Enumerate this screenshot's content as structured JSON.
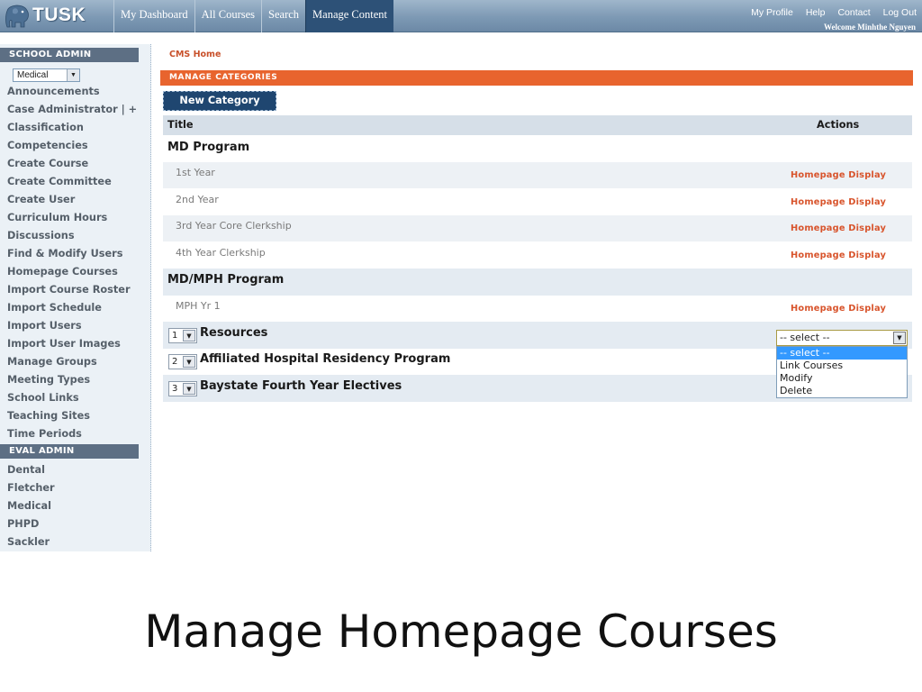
{
  "app": {
    "logo_text": "TUSK",
    "nav_tabs": [
      {
        "label": "My Dashboard"
      },
      {
        "label": "All Courses"
      },
      {
        "label": "Search"
      },
      {
        "label": "Manage Content",
        "active": true
      }
    ],
    "user_links": [
      "My Profile",
      "Help",
      "Contact",
      "Log Out"
    ],
    "welcome": "Welcome Minhthe Nguyen"
  },
  "sidebar": {
    "school_admin_header": "SCHOOL ADMIN",
    "school_select_value": "Medical",
    "admin_links": [
      "Announcements",
      "Case Administrator | +",
      "Classification",
      "Competencies",
      "Create Course",
      "Create Committee",
      "Create User",
      "Curriculum Hours",
      "Discussions",
      "Find & Modify Users",
      "Homepage Courses",
      "Import Course Roster",
      "Import Schedule",
      "Import Users",
      "Import User Images",
      "Manage Groups",
      "Meeting Types",
      "School Links",
      "Teaching Sites",
      "Time Periods"
    ],
    "eval_admin_header": "EVAL ADMIN",
    "eval_links": [
      "Dental",
      "Fletcher",
      "Medical",
      "PHPD",
      "Sackler"
    ]
  },
  "main": {
    "breadcrumb": "CMS Home",
    "section_title": "MANAGE CATEGORIES",
    "new_category_label": "New Category",
    "table_headers": {
      "title": "Title",
      "actions": "Actions"
    },
    "categories": [
      {
        "title": "MD Program",
        "items": [
          {
            "title": "1st Year",
            "action": "Homepage Display"
          },
          {
            "title": "2nd Year",
            "action": "Homepage Display"
          },
          {
            "title": "3rd Year Core Clerkship",
            "action": "Homepage Display"
          },
          {
            "title": "4th Year Clerkship",
            "action": "Homepage Display"
          }
        ]
      },
      {
        "title": "MD/MPH Program",
        "items": [
          {
            "title": "MPH Yr 1",
            "action": "Homepage Display"
          }
        ]
      }
    ],
    "ordered_categories": [
      {
        "order": "1",
        "title": "Resources"
      },
      {
        "order": "2",
        "title": "Affiliated Hospital Residency Program"
      },
      {
        "order": "3",
        "title": "Baystate Fourth Year Electives"
      }
    ],
    "action_select": {
      "value": "-- select --",
      "options": [
        "-- select --",
        "Link Courses",
        "Modify",
        "Delete"
      ]
    }
  },
  "slide_title": "Manage Homepage Courses",
  "colors": {
    "topbar": "#7d99b4",
    "active_tab": "#2d5177",
    "section_bar": "#e8642e",
    "action_link": "#d8542c",
    "sidebar_bg": "#ebf1f6"
  }
}
